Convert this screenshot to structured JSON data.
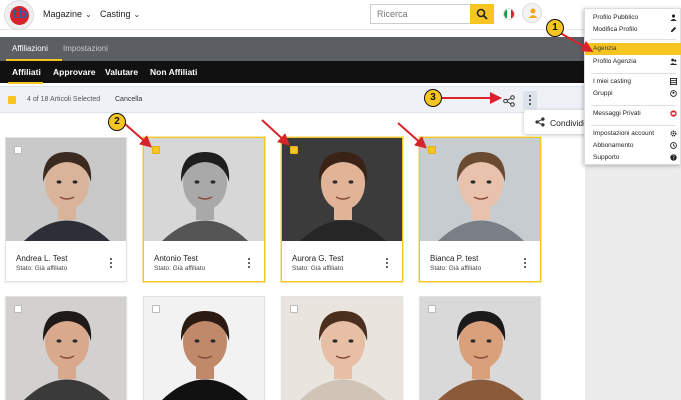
{
  "nav": {
    "menus": [
      "Magazine",
      "Casting"
    ],
    "search_placeholder": "Ricerca"
  },
  "subheader": {
    "tabs": [
      "Affiliazioni",
      "Impostazioni"
    ]
  },
  "tabs": [
    "Affiliati",
    "Approvare",
    "Valutare",
    "Non Affiliati"
  ],
  "selection": {
    "count_text": "4 of 18 Articoli Selected",
    "cancel_label": "Cancella"
  },
  "share_popup": {
    "label": "Condividi"
  },
  "dropdown": {
    "items": [
      {
        "label": "Profilo Pubblico",
        "icon": "person-icon"
      },
      {
        "label": "Modifica Profilo",
        "icon": "pencil-icon"
      },
      {
        "label": "Agenzia",
        "icon": "",
        "highlighted": true
      },
      {
        "label": "Profilo Agenzia",
        "icon": "people-icon"
      },
      {
        "label": "I miei casting",
        "icon": "grid-icon"
      },
      {
        "label": "Gruppi",
        "icon": "group-icon"
      },
      {
        "label": "Messaggi Privati",
        "icon": "message-icon"
      },
      {
        "label": "Impostazioni account",
        "icon": "gear-icon"
      },
      {
        "label": "Abbonamento",
        "icon": "clock-icon"
      },
      {
        "label": "Supporto",
        "icon": "help-icon"
      }
    ]
  },
  "cards": [
    {
      "name": "Andrea L. Test",
      "status": "Stato: Già affiliato",
      "selected": false
    },
    {
      "name": "Antonio Test",
      "status": "Stato: Già affiliato",
      "selected": true
    },
    {
      "name": "Aurora G. Test",
      "status": "Stato: Già affiliato",
      "selected": true
    },
    {
      "name": "Bianca P. test",
      "status": "Stato: Già affiliato",
      "selected": true
    },
    {
      "name": "",
      "status": "",
      "selected": false
    },
    {
      "name": "",
      "status": "",
      "selected": false
    },
    {
      "name": "",
      "status": "",
      "selected": false
    },
    {
      "name": "",
      "status": "",
      "selected": false
    }
  ],
  "annotations": [
    "1",
    "2",
    "3"
  ],
  "colors": {
    "accent": "#f7c51f",
    "dark": "#111111",
    "header_gray": "#5b5e63",
    "arrow_red": "#d8232a"
  }
}
